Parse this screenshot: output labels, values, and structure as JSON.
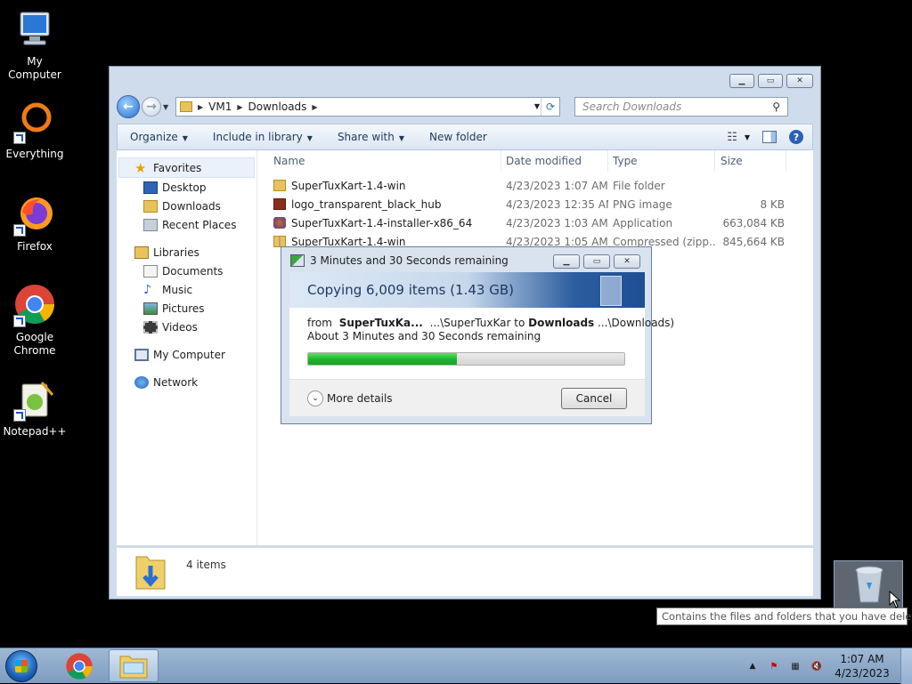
{
  "desktop": {
    "icons": [
      {
        "label": "My Computer"
      },
      {
        "label": "Everything"
      },
      {
        "label": "Firefox"
      },
      {
        "label": "Google Chrome"
      },
      {
        "label": "Notepad++"
      }
    ]
  },
  "explorer": {
    "breadcrumb": [
      "VM1",
      "Downloads"
    ],
    "search_placeholder": "Search Downloads",
    "toolbar": {
      "organize": "Organize",
      "include_in_library": "Include in library",
      "share_with": "Share with",
      "new_folder": "New folder"
    },
    "nav": {
      "favorites": "Favorites",
      "favorites_items": [
        "Desktop",
        "Downloads",
        "Recent Places"
      ],
      "libraries": "Libraries",
      "libraries_items": [
        "Documents",
        "Music",
        "Pictures",
        "Videos"
      ],
      "my_computer": "My Computer",
      "network": "Network"
    },
    "columns": {
      "name": "Name",
      "date": "Date modified",
      "type": "Type",
      "size": "Size"
    },
    "files": [
      {
        "name": "SuperTuxKart-1.4-win",
        "date": "4/23/2023 1:07 AM",
        "type": "File folder",
        "size": ""
      },
      {
        "name": "logo_transparent_black_hub",
        "date": "4/23/2023 12:35 AM",
        "type": "PNG image",
        "size": "8 KB"
      },
      {
        "name": "SuperTuxKart-1.4-installer-x86_64",
        "date": "4/23/2023 1:03 AM",
        "type": "Application",
        "size": "663,084 KB"
      },
      {
        "name": "SuperTuxKart-1.4-win",
        "date": "4/23/2023 1:05 AM",
        "type": "Compressed (zipp...",
        "size": "845,664 KB"
      }
    ],
    "status": "4 items"
  },
  "copy_dialog": {
    "title": "3 Minutes and 30 Seconds remaining",
    "heading": "Copying 6,009 items (1.43 GB)",
    "from_label": "from",
    "from_name": "SuperTuxKa...",
    "from_path": "...\\SuperTuxKar",
    "to_label": "to",
    "to_name": "Downloads",
    "to_path": "...\\Downloads)",
    "remaining": "About 3 Minutes and 30 Seconds remaining",
    "progress": 0.47,
    "more_details": "More details",
    "cancel": "Cancel"
  },
  "tooltip": "Contains the files and folders that you have deleted.",
  "taskbar": {
    "time": "1:07 AM",
    "date": "4/23/2023"
  },
  "colors": {
    "progress_green": "#1cb32e",
    "taskbar": "#8eaacb",
    "selection": "#eaf1fb"
  }
}
